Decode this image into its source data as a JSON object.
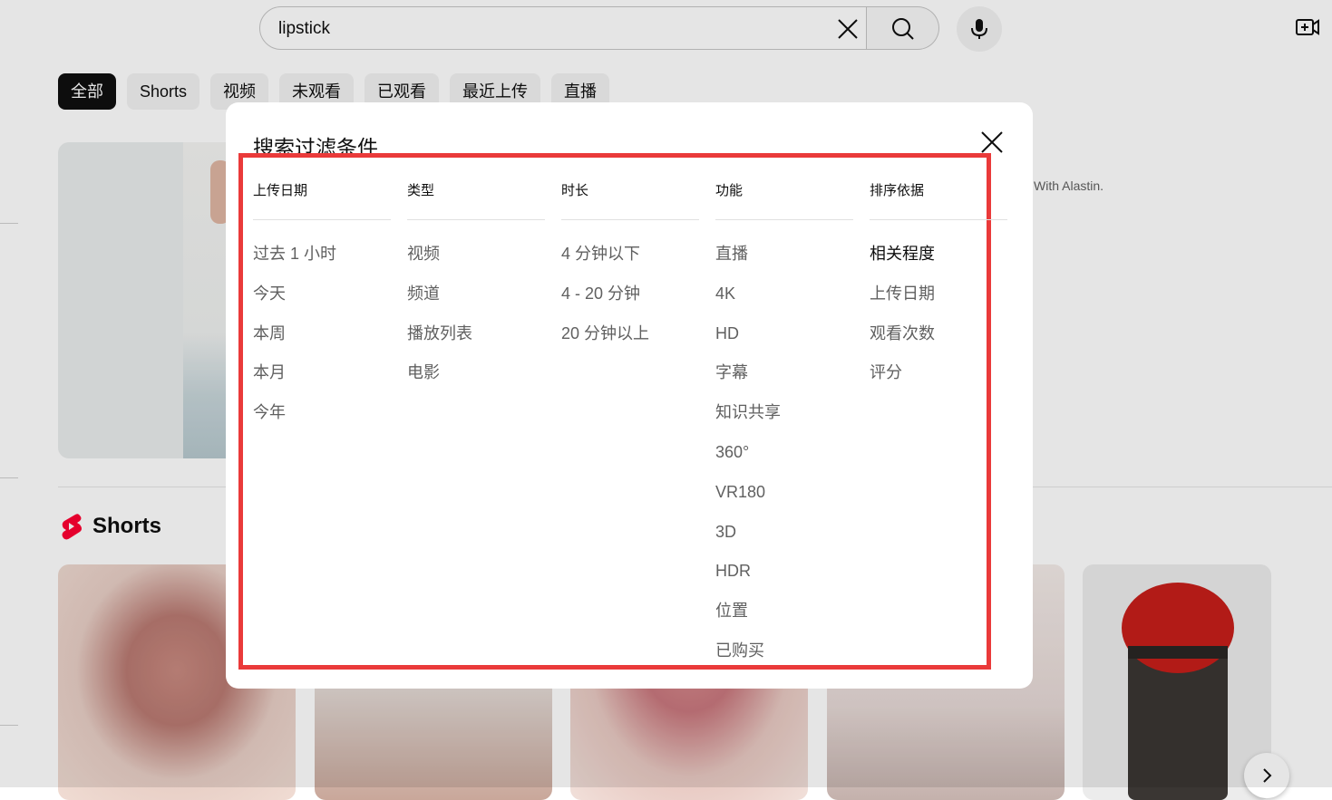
{
  "search": {
    "query": "lipstick"
  },
  "chips": [
    "全部",
    "Shorts",
    "视频",
    "未观看",
    "已观看",
    "最近上传",
    "直播"
  ],
  "result": {
    "snippet": "With Alastin."
  },
  "shorts": {
    "title": "Shorts"
  },
  "dialog": {
    "title": "搜索过滤条件",
    "columns": [
      {
        "header": "上传日期",
        "items": [
          "过去 1 小时",
          "今天",
          "本周",
          "本月",
          "今年"
        ]
      },
      {
        "header": "类型",
        "items": [
          "视频",
          "频道",
          "播放列表",
          "电影"
        ]
      },
      {
        "header": "时长",
        "items": [
          "4 分钟以下",
          "4 - 20 分钟",
          "20 分钟以上"
        ]
      },
      {
        "header": "功能",
        "items": [
          "直播",
          "4K",
          "HD",
          "字幕",
          "知识共享",
          "360°",
          "VR180",
          "3D",
          "HDR",
          "位置",
          "已购买"
        ]
      },
      {
        "header": "排序依据",
        "items": [
          "相关程度",
          "上传日期",
          "观看次数",
          "评分"
        ]
      }
    ]
  },
  "colors": {
    "highlight": "#ea3a3a",
    "shorts_red": "#ff0033",
    "active_chip": "#0f0f0f"
  }
}
